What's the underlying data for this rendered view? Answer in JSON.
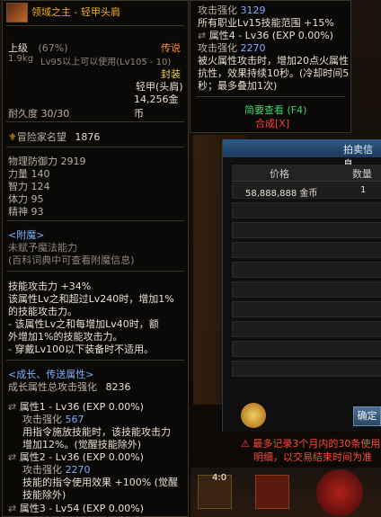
{
  "tooltip": {
    "item_name": "领域之主 - 轻甲头肩",
    "grade_label": "上级",
    "grade_pct": "(67%)",
    "rarity": "传说",
    "weight": "1.9kg",
    "level_req": "Lv95以上可以使用(Lv105 - 10)",
    "sealed": "封装",
    "type": "轻甲(头肩)",
    "price": "14,256金币",
    "durability": "耐久度 30/30",
    "reputation_label": "冒险家名望",
    "reputation_value": "1876",
    "stats": [
      {
        "label": "物理防御力",
        "value": "2919"
      },
      {
        "label": "力量",
        "value": "140"
      },
      {
        "label": "智力",
        "value": "124"
      },
      {
        "label": "体力",
        "value": "95"
      },
      {
        "label": "精神",
        "value": "93"
      }
    ],
    "enchant_header": "<附魔>",
    "enchant_none": "未赋予魔法能力",
    "enchant_hint": "(百科词典中可查看附魔信息)",
    "skill_lines": [
      "技能攻击力 +34%",
      "该属性Lv之和超过Lv240时，增加1%",
      "的技能攻击力。",
      "- 该属性Lv之和每增加Lv40时，额",
      "外增加1%的技能攻击力。",
      "- 穿戴Lv100以下装备时不适用。"
    ],
    "growth_header": "<成长、传送属性>",
    "growth_total_label": "成长属性总攻击强化",
    "growth_total_value": "8236",
    "attr1_title": "属性1 - Lv36 (EXP 0.00%)",
    "attr1_atk_label": "攻击强化",
    "attr1_atk_value": "567",
    "attr1_desc1": "用指令施放技能时，该技能攻击力",
    "attr1_desc2": "增加12%。(觉醒技能除外)",
    "attr2_title": "属性2 - Lv36 (EXP 0.00%)",
    "attr2_atk_label": "攻击强化",
    "attr2_atk_value": "2270",
    "attr2_desc1": "技能的指令使用效果 +100% (觉醒",
    "attr2_desc2": "技能除外)",
    "attr3_title": "属性3 - Lv54 (EXP 0.00%)"
  },
  "tooltip2": {
    "atk_label": "攻击强化",
    "atk_value": "3129",
    "line1": "所有职业Lv15技能范围 +15%",
    "attr4_title": "属性4 - Lv36 (EXP 0.00%)",
    "attr4_atk_label": "攻击强化",
    "attr4_atk_value": "2270",
    "desc1": "被火属性攻击时，增加20点火属性",
    "desc2": "抗性，效果持续10秒。(冷却时间5",
    "desc3": "秒；最多叠加1次)",
    "brief_view": "简要查看 (F4)",
    "compose": "合成[X]"
  },
  "auction": {
    "title": "拍卖信息",
    "col_price": "价格",
    "col_qty": "数量",
    "rows": [
      {
        "price": "58,888,888 金币",
        "qty": "1"
      }
    ],
    "confirm": "确定",
    "warning1": "⚠ 最多记录3个月内的30条使用",
    "warning2": "明细，以交易结束时间为准"
  },
  "bottom": {
    "badge": "4:0"
  }
}
